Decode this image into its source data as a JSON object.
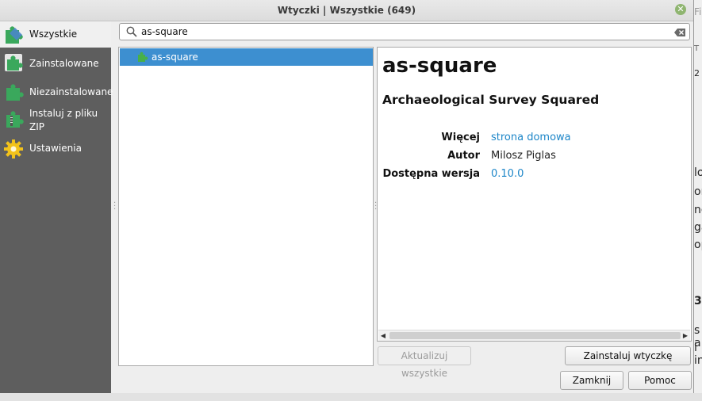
{
  "window": {
    "title": "Wtyczki | Wszystkie (649)"
  },
  "sidebar": {
    "items": [
      {
        "label": "Wszystkie",
        "icon": "puzzle-all-icon"
      },
      {
        "label": "Zainstalowane",
        "icon": "puzzle-installed-icon"
      },
      {
        "label": "Niezainstalowane",
        "icon": "puzzle-not-installed-icon"
      },
      {
        "label": "Instaluj z pliku ZIP",
        "icon": "zip-install-icon"
      },
      {
        "label": "Ustawienia",
        "icon": "gear-icon"
      }
    ]
  },
  "search": {
    "value": "as-square"
  },
  "plugin_list": {
    "items": [
      {
        "label": "as-square",
        "selected": true
      }
    ]
  },
  "details": {
    "name": "as-square",
    "subtitle": "Archaeological Survey Squared",
    "more_label": "Więcej",
    "more_value": "strona domowa",
    "author_label": "Autor",
    "author_value": "Milosz Piglas",
    "version_label": "Dostępna wersja",
    "version_value": "0.10.0"
  },
  "buttons": {
    "upgrade_all": "Aktualizuj wszystkie",
    "install": "Zainstaluj wtyczkę",
    "close": "Zamknij",
    "help": "Pomoc"
  },
  "colors": {
    "accent": "#3d8fd0",
    "link": "#1d86c8",
    "sidebar": "#5e5e5e"
  }
}
